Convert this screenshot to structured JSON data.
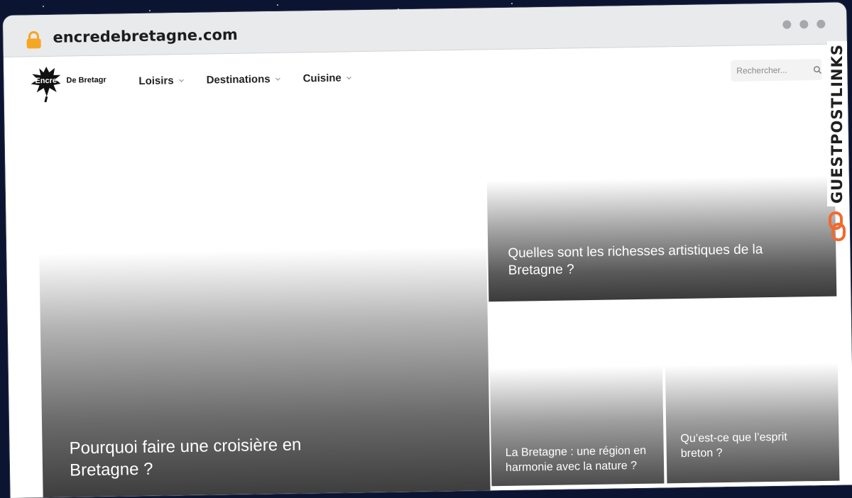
{
  "browser": {
    "url": "encredebretagne.com"
  },
  "header": {
    "logo_text_main": "Encre",
    "logo_text_sub": "De Bretagne",
    "nav": [
      {
        "label": "Loisirs"
      },
      {
        "label": "Destinations"
      },
      {
        "label": "Cuisine"
      }
    ],
    "search_placeholder": "Rechercher..."
  },
  "articles": {
    "featured": {
      "title": "Pourquoi faire une croisière en Bretagne ?"
    },
    "top_right": {
      "title": "Quelles sont les richesses artistiques de la Bretagne ?"
    },
    "bottom_left": {
      "title": "La Bretagne : une région en harmonie avec la nature ?"
    },
    "bottom_right": {
      "title": "Qu’est-ce que l’esprit breton ?"
    }
  },
  "watermark": {
    "text": "GUESTPOSTLINKS",
    "accent_color": "#f26a2e"
  }
}
